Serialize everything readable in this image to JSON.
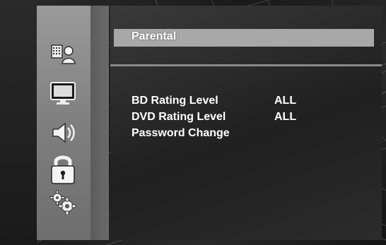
{
  "menu": {
    "title": "Parental",
    "items": [
      {
        "label": "BD Rating Level",
        "value": "ALL"
      },
      {
        "label": "DVD Rating Level",
        "value": "ALL"
      },
      {
        "label": "Password Change",
        "value": ""
      }
    ]
  },
  "sidebar": {
    "icons": [
      "display-setup-icon",
      "tv-screen-icon",
      "speaker-icon",
      "padlock-icon",
      "gears-icon"
    ]
  },
  "colors": {
    "title_bar": "#a8a8a8",
    "text": "#ffffff",
    "sidebar": "#8a8a8a"
  }
}
